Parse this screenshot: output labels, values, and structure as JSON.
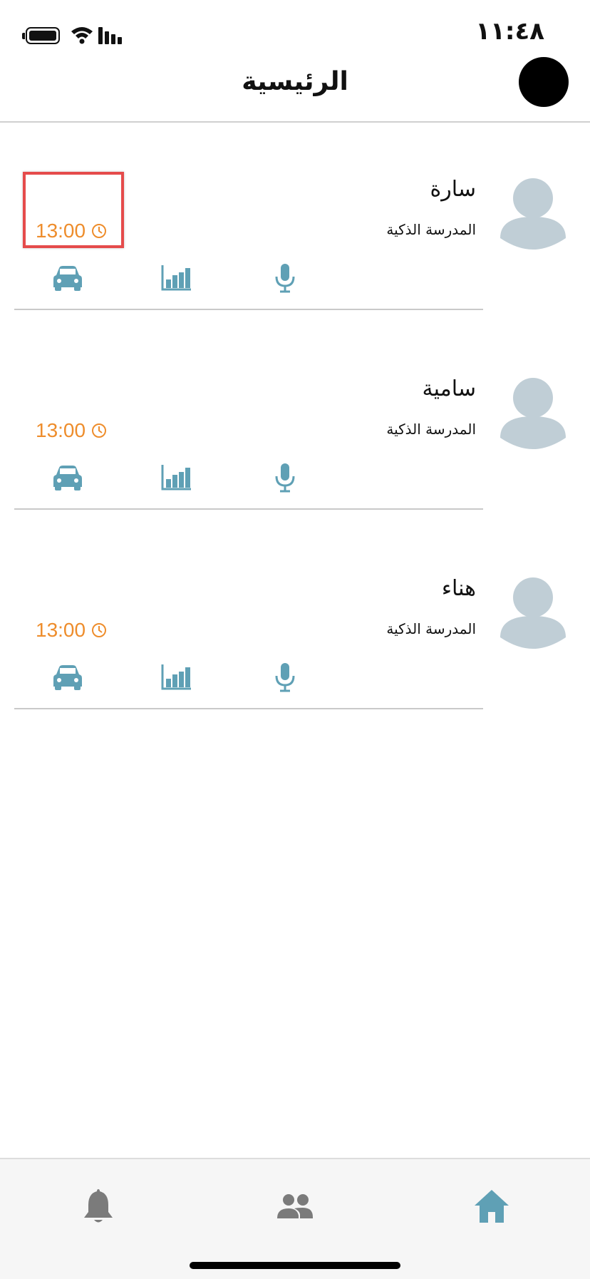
{
  "status_bar": {
    "time": "١١:٤٨"
  },
  "header": {
    "title": "الرئيسية"
  },
  "students": [
    {
      "name": "سارة",
      "school": "المدرسة الذكية",
      "time": "13:00"
    },
    {
      "name": "سامية",
      "school": "المدرسة الذكية",
      "time": "13:00"
    },
    {
      "name": "هناء",
      "school": "المدرسة الذكية",
      "time": "13:00"
    }
  ],
  "icons": {
    "status": [
      "battery-icon",
      "wifi-icon",
      "signal-icon"
    ],
    "card_actions": [
      "car-icon",
      "bar-chart-icon",
      "microphone-icon"
    ],
    "time": "clock-icon",
    "tabs": [
      "bell-icon",
      "people-icon",
      "home-icon"
    ]
  },
  "colors": {
    "accent": "#5fa0b5",
    "time": "#ee8d2c",
    "avatar": "#c0ced6",
    "tab_inactive": "#7b7b7b",
    "highlight": "#e54b4b"
  }
}
